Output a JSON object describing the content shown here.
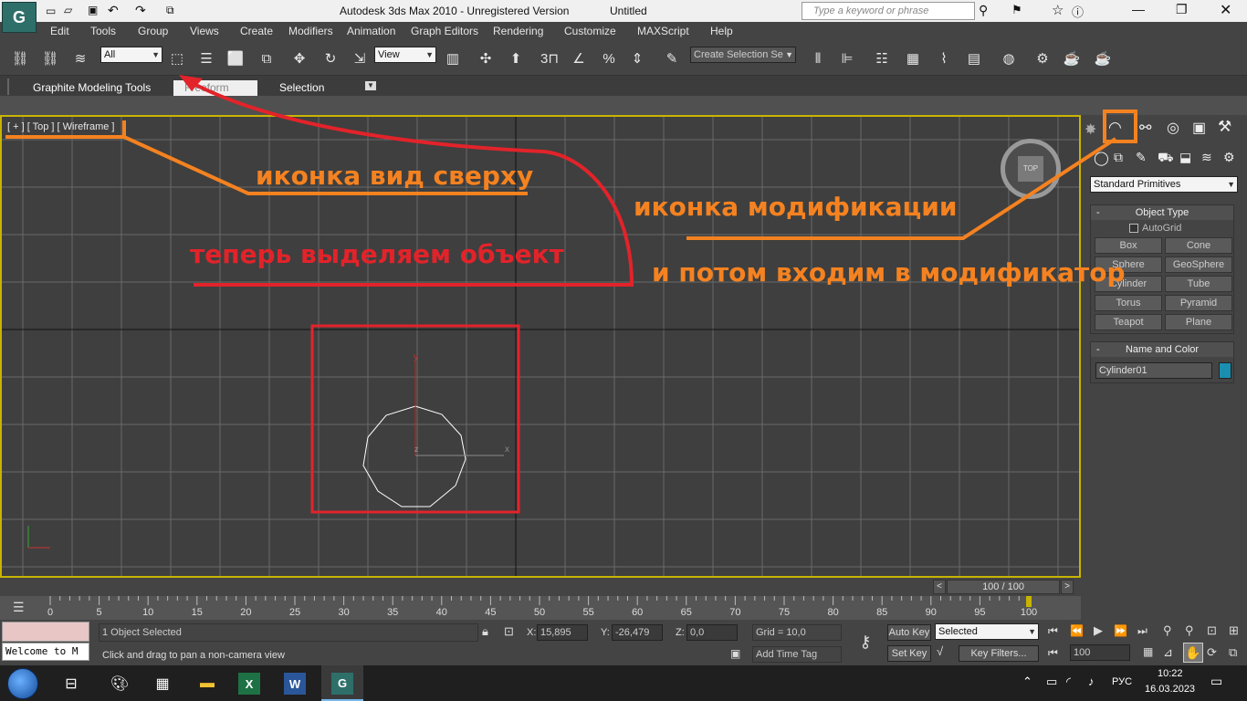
{
  "titlebar": {
    "app_title": "Autodesk 3ds Max  2010  - Unregistered Version",
    "doc_title": "Untitled",
    "search_placeholder": "Type a keyword or phrase"
  },
  "menu": [
    "Edit",
    "Tools",
    "Group",
    "Views",
    "Create",
    "Modifiers",
    "Animation",
    "Graph Editors",
    "Rendering",
    "Customize",
    "MAXScript",
    "Help"
  ],
  "toolbar": {
    "selection_filter": "All",
    "ref_coord": "View",
    "named_selection": "Create Selection Se",
    "snap_3": "3"
  },
  "ribbon": {
    "title": "Graphite Modeling Tools",
    "tabs": [
      "Freeform",
      "Selection"
    ]
  },
  "viewport": {
    "label": "[ + ] [ Top ] [ Wireframe ]",
    "viewcube_label": "TOP",
    "axis_y": "y",
    "axis_x": "x",
    "axis_z": "z"
  },
  "annotations": {
    "top_view": "иконка вид сверху",
    "modify_icon": "иконка модификации",
    "select_object": "теперь выделяем объект",
    "enter_modifier": "и потом входим в модификатор"
  },
  "timeline": {
    "frame_counter": "100 / 100",
    "ticks": [
      "0",
      "5",
      "10",
      "15",
      "20",
      "25",
      "30",
      "35",
      "40",
      "45",
      "50",
      "55",
      "60",
      "65",
      "70",
      "75",
      "80",
      "85",
      "90",
      "95",
      "100"
    ]
  },
  "command_panel": {
    "category": "Standard Primitives",
    "object_type_title": "Object Type",
    "autogrid": "AutoGrid",
    "primitives": [
      "Box",
      "Cone",
      "Sphere",
      "GeoSphere",
      "Cylinder",
      "Tube",
      "Torus",
      "Pyramid",
      "Teapot",
      "Plane"
    ],
    "name_color_title": "Name and Color",
    "object_name": "Cylinder01",
    "object_color": "#1a8fb0"
  },
  "status": {
    "maxscript_listener": "Welcome to M",
    "selection_info": "1 Object Selected",
    "prompt": "Click and drag to pan a non-camera view",
    "x_label": "X:",
    "x_value": "15,895",
    "y_label": "Y:",
    "y_value": "-26,479",
    "z_label": "Z:",
    "z_value": "0,0",
    "grid": "Grid = 10,0",
    "add_time_tag": "Add Time Tag",
    "auto_key": "Auto Key",
    "set_key": "Set Key",
    "key_mode": "Selected",
    "key_filters": "Key Filters...",
    "frame": "100"
  },
  "taskbar": {
    "lang": "РУС",
    "time": "10:22",
    "date": "16.03.2023"
  }
}
